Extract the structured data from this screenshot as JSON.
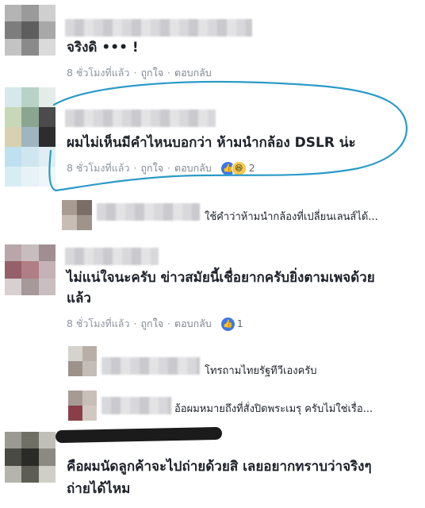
{
  "comments": [
    {
      "text": "จริงดิ ••• !",
      "time": "8 ชั่วโมงที่แล้ว",
      "like": "ถูกใจ",
      "reply": "ตอบกลับ"
    },
    {
      "text": "ผมไม่เห็นมีคำไหนบอกว่า ห้ามนำกล้อง DSLR น่ะ",
      "time": "8 ชั่วโมงที่แล้ว",
      "like": "ถูกใจ",
      "reply": "ตอบกลับ",
      "reactions": "2"
    },
    {
      "line1": "ไม่แน่ใจนะครับ ข่าวสมัยนี้เชื่อยากครับยิ่งตามเพจด้วย",
      "line2": "แล้ว",
      "time": "8 ชั่วโมงที่แล้ว",
      "like": "ถูกใจ",
      "reply": "ตอบกลับ",
      "reactions": "1"
    },
    {
      "line1": "คือผมนัดลูกค้าจะไปถ่ายด้วยสิ เลยอยากทราบว่าจริงๆ",
      "line2": "ถ่ายได้ไหม"
    }
  ],
  "replies": [
    {
      "text": "ใช้คำว่าห้ามนำกล้องที่เปลี่ยนเลนส์ได้..."
    },
    {
      "text": "โทรถามไทยรัฐทีวีเองครับ"
    },
    {
      "text": "อ้อผมหมายถึงที่สั่งปิดพระเมรุ ครับไม่ใช่เรื่อ..."
    }
  ],
  "icons": {
    "like": "thumbs-up-icon",
    "haha": "haha-emoji-icon"
  },
  "colors": {
    "highlight": "#2b9bc7",
    "meta": "#8d949e",
    "like": "#3b78e7"
  }
}
